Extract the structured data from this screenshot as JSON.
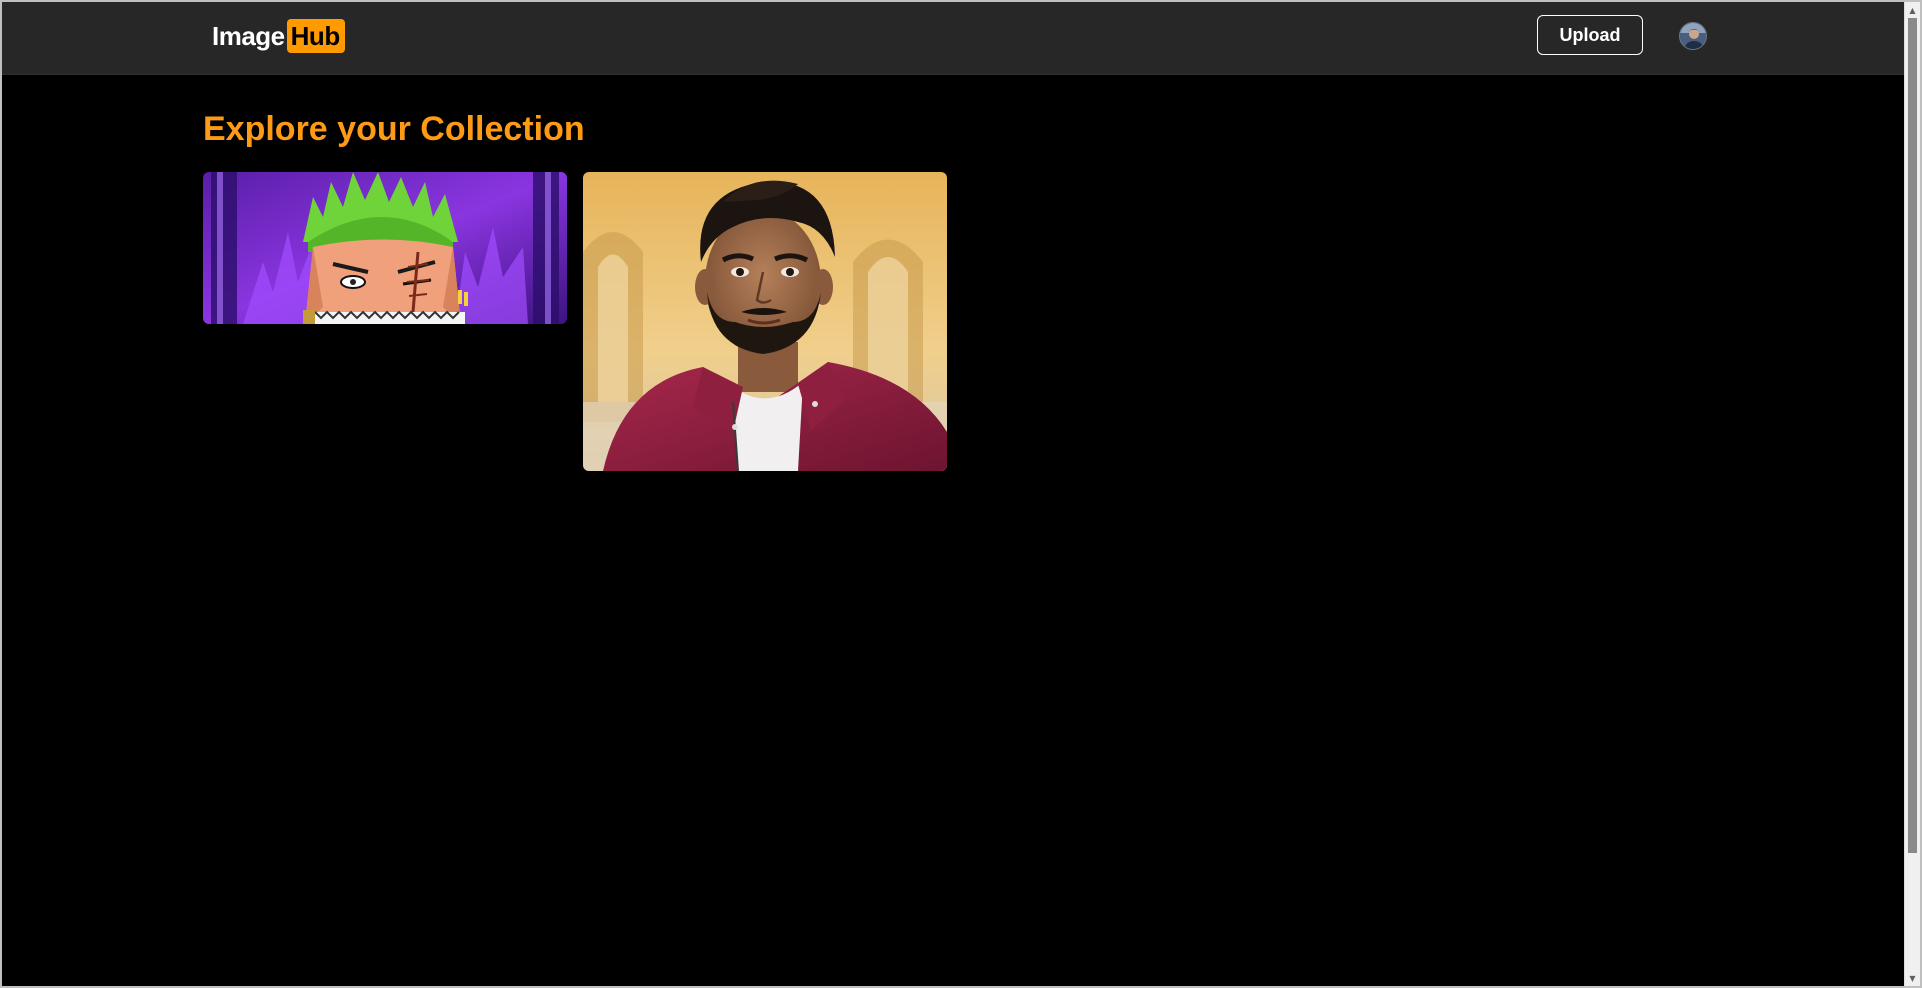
{
  "app": {
    "logo": {
      "part1": "Image",
      "part2": "Hub"
    },
    "header": {
      "upload_label": "Upload"
    }
  },
  "main": {
    "title": "Explore your Collection",
    "images": [
      {
        "name": "anime-character-image"
      },
      {
        "name": "portrait-photo-image"
      }
    ]
  },
  "colors": {
    "accent": "#ff9a00",
    "navbar_bg": "#272727",
    "page_bg": "#000000",
    "title": "#ff9a14"
  }
}
